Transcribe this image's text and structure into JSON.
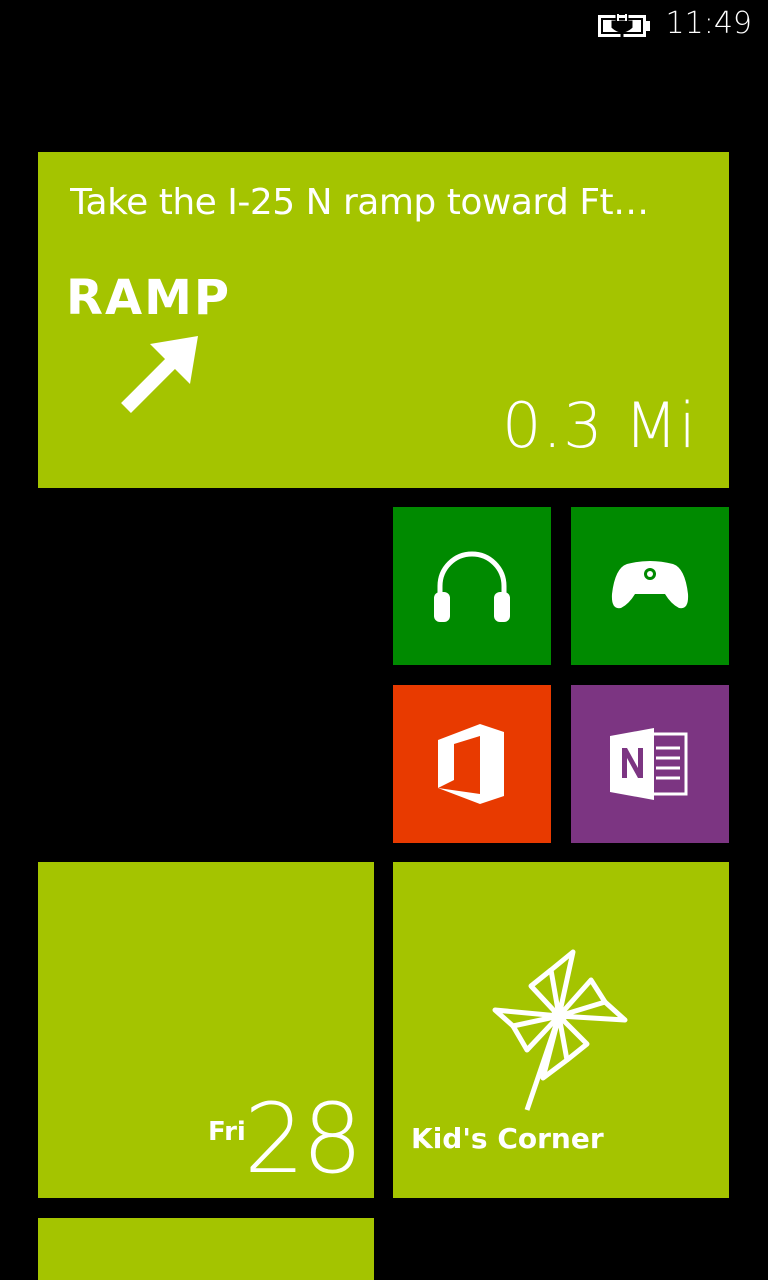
{
  "colors": {
    "lime": "#a4c400",
    "green": "#008a00",
    "orange": "#e83a00",
    "purple": "#7c3582",
    "background": "#000000"
  },
  "status_bar": {
    "time": "11:49",
    "battery_icon": "battery-charging-icon"
  },
  "tiles": {
    "navigation": {
      "instruction": "Take the I-25 N ramp toward Ft…",
      "sign": "RAMP",
      "distance": "0.3 Mi",
      "icon": "ramp-arrow-icon"
    },
    "music": {
      "icon": "headphones-icon"
    },
    "games": {
      "icon": "gamepad-icon"
    },
    "office": {
      "icon": "office-icon"
    },
    "onenote": {
      "icon": "onenote-icon"
    },
    "calendar": {
      "day": "Fri",
      "date": "28"
    },
    "kids_corner": {
      "label": "Kid's Corner",
      "icon": "pinwheel-icon"
    }
  }
}
